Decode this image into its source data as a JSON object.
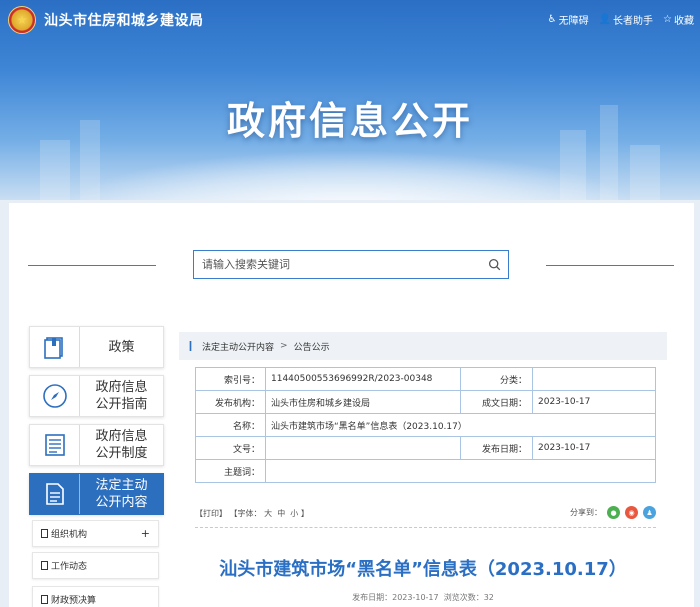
{
  "header": {
    "site_name": "汕头市住房和城乡建设局",
    "links": [
      {
        "icon": "accessibility-icon",
        "label": "无障碍"
      },
      {
        "icon": "elder-assist-icon",
        "label": "长者助手"
      },
      {
        "icon": "star-icon",
        "label": "收藏"
      }
    ],
    "banner_title": "政府信息公开"
  },
  "search": {
    "placeholder": "请输入搜索关键词"
  },
  "sidebar": {
    "items": [
      {
        "label": "政策",
        "icon": "book-icon"
      },
      {
        "label": "政府信息\n公开指南",
        "icon": "compass-icon"
      },
      {
        "label": "政府信息\n公开制度",
        "icon": "list-doc-icon"
      },
      {
        "label": "法定主动\n公开内容",
        "icon": "document-icon",
        "active": true
      }
    ],
    "subitems": [
      {
        "label": "组织机构",
        "expand": "+"
      },
      {
        "label": "工作动态"
      },
      {
        "label": "财政预决算"
      }
    ]
  },
  "breadcrumb": {
    "items": [
      "法定主动公开内容",
      "公告公示"
    ],
    "separator": ">"
  },
  "meta": {
    "index_label": "索引号：",
    "index_value": "11440500553696992R/2023-00348",
    "category_label": "分类：",
    "category_value": "",
    "publisher_label": "发布机构：",
    "publisher_value": "汕头市住房和城乡建设局",
    "created_label": "成文日期：",
    "created_value": "2023-10-17",
    "name_label": "名称：",
    "name_value": "汕头市建筑市场“黑名单”信息表（2023.10.17）",
    "docno_label": "文号：",
    "docno_value": "",
    "pubdate_label": "发布日期：",
    "pubdate_value": "2023-10-17",
    "subject_label": "主题词：",
    "subject_value": ""
  },
  "tools": {
    "print": "【打印】",
    "font_prefix": "【字体：",
    "font_large": "大",
    "font_medium": "中",
    "font_small": "小",
    "font_suffix": "】",
    "share_label": "分享到："
  },
  "colors": {
    "wechat": "#4caf50",
    "weibo": "#e9573f",
    "qq": "#4aa3df",
    "brand": "#2a6fc4"
  },
  "article": {
    "title": "汕头市建筑市场“黑名单”信息表（2023.10.17）",
    "pubdate_label": "发布日期：",
    "pubdate": "2023-10-17",
    "views_label": "浏览次数：",
    "views": "32"
  }
}
